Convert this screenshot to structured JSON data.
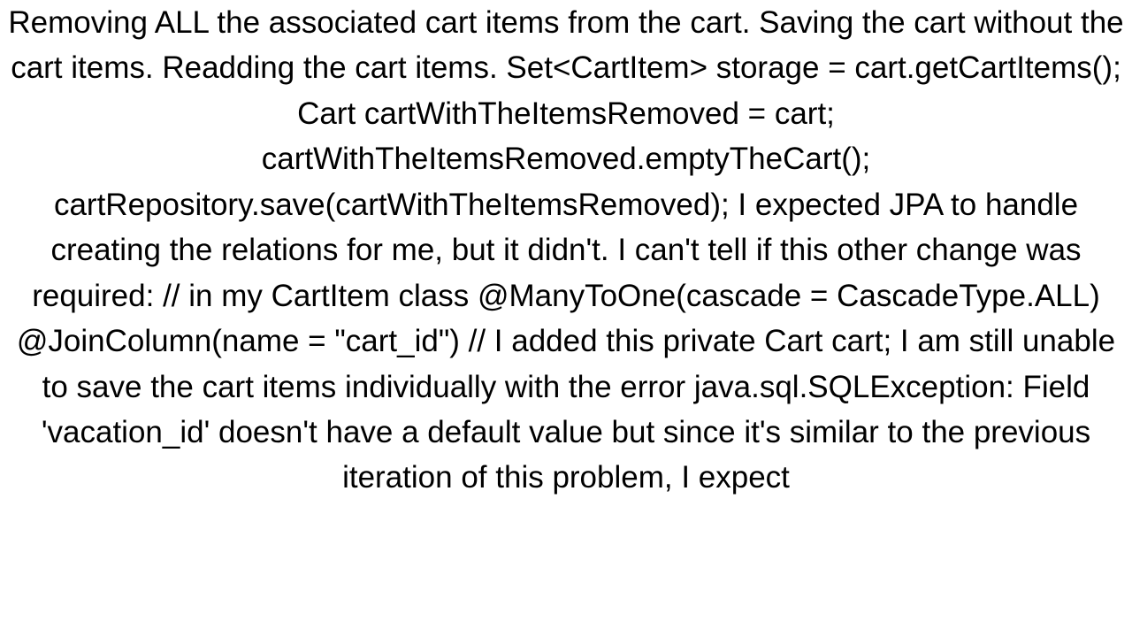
{
  "document": {
    "text": "Removing ALL the associated cart items from the cart. Saving the cart without the cart items. Readding the cart items. Set<CartItem> storage = cart.getCartItems(); Cart cartWithTheItemsRemoved = cart; cartWithTheItemsRemoved.emptyTheCart(); cartRepository.save(cartWithTheItemsRemoved);  I expected JPA to handle creating the relations for me, but it didn't. I can't tell if this other change was required: // in my CartItem class     @ManyToOne(cascade = CascadeType.ALL)     @JoinColumn(name = \"cart_id\") // I added this     private Cart cart;  I am still unable to save the cart items individually with the error java.sql.SQLException: Field 'vacation_id' doesn't have a default value but since it's similar to the previous iteration of this problem, I expect"
  }
}
